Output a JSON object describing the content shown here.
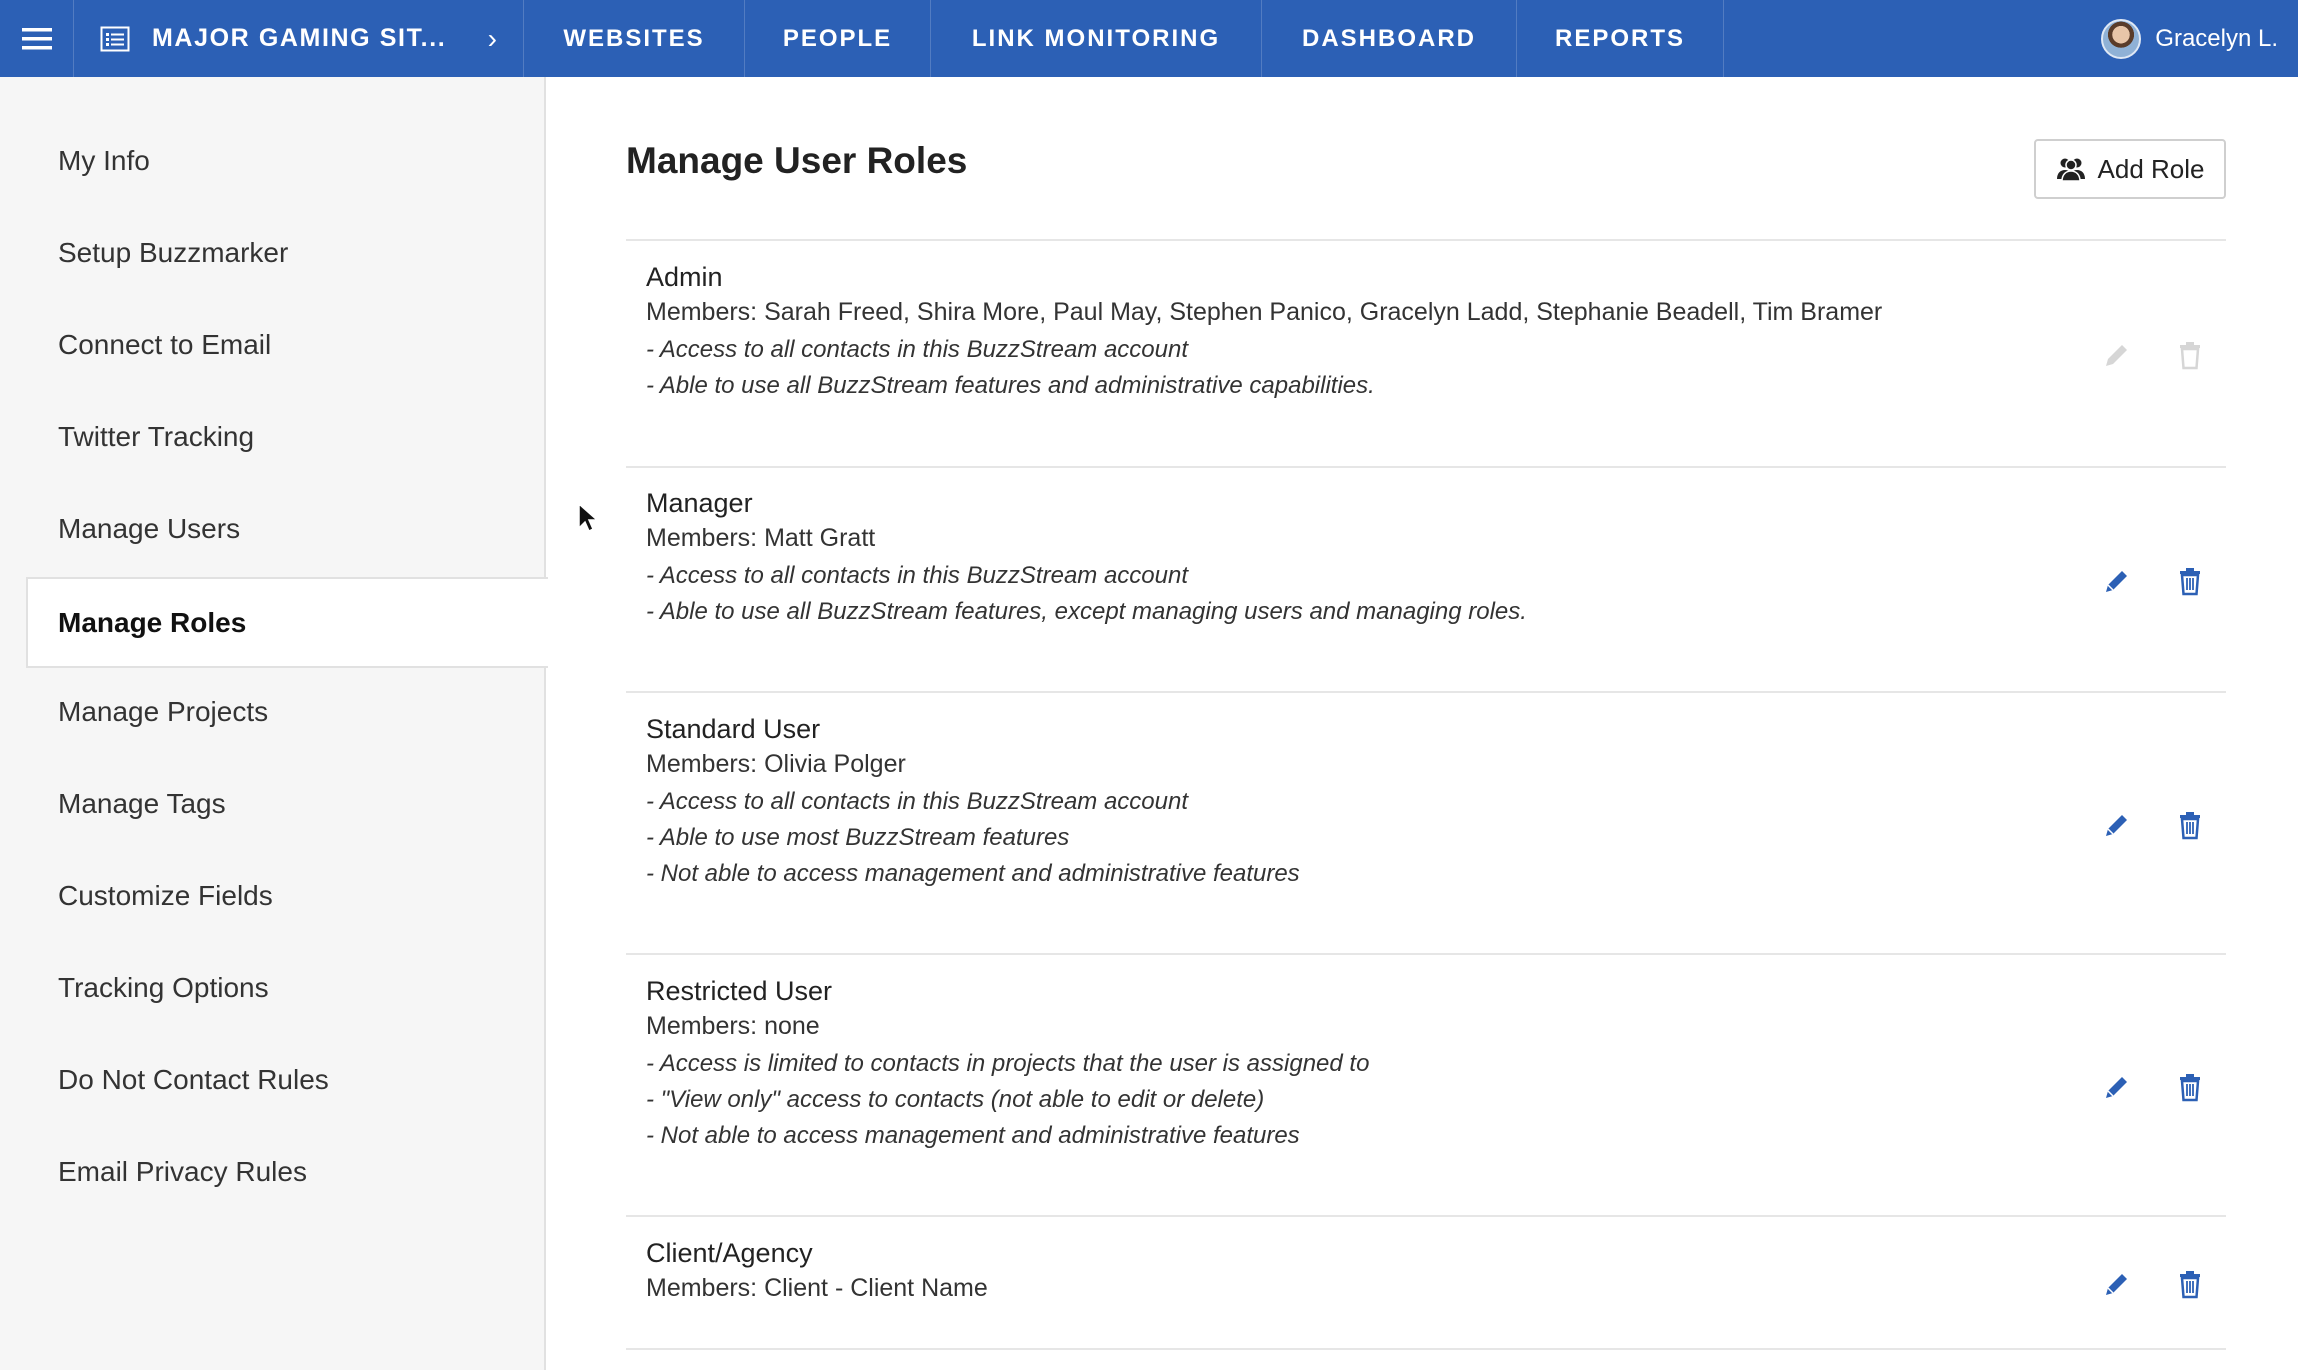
{
  "topbar": {
    "project_name": "MAJOR GAMING SIT...",
    "tabs": [
      "WEBSITES",
      "PEOPLE",
      "LINK MONITORING",
      "DASHBOARD",
      "REPORTS"
    ],
    "user_name": "Gracelyn L."
  },
  "sidebar": {
    "items": [
      "My Info",
      "Setup Buzzmarker",
      "Connect to Email",
      "Twitter Tracking",
      "Manage Users",
      "Manage Roles",
      "Manage Projects",
      "Manage Tags",
      "Customize Fields",
      "Tracking Options",
      "Do Not Contact Rules",
      "Email Privacy Rules"
    ],
    "active": "Manage Roles"
  },
  "main": {
    "title": "Manage User Roles",
    "add_role_label": "Add Role",
    "roles": [
      {
        "name": "Admin",
        "members": "Members: Sarah Freed, Shira More, Paul May, Stephen Panico, Gracelyn Ladd, Stephanie Beadell, Tim Bramer",
        "desc": [
          "- Access to all contacts in this BuzzStream account",
          "- Able to use all BuzzStream features and administrative capabilities."
        ],
        "editable": false
      },
      {
        "name": "Manager",
        "members": "Members: Matt Gratt",
        "desc": [
          "- Access to all contacts in this BuzzStream account",
          "- Able to use all BuzzStream features, except managing users and managing roles."
        ],
        "editable": true
      },
      {
        "name": "Standard User",
        "members": "Members: Olivia Polger",
        "desc": [
          "- Access to all contacts in this BuzzStream account",
          "- Able to use most BuzzStream features",
          "- Not able to access management and administrative features"
        ],
        "editable": true
      },
      {
        "name": "Restricted User",
        "members": "Members: none",
        "desc": [
          "- Access is limited to contacts in projects that the user is assigned to",
          "- \"View only\" access to contacts (not able to edit or delete)",
          "- Not able to access management and administrative features"
        ],
        "editable": true
      },
      {
        "name": "Client/Agency",
        "members": "Members: Client - Client Name",
        "desc": [],
        "editable": true
      }
    ]
  },
  "colors": {
    "nav_bg": "#2c60b5",
    "icon_blue": "#2c60b5",
    "icon_disabled": "#d6d6d6"
  }
}
